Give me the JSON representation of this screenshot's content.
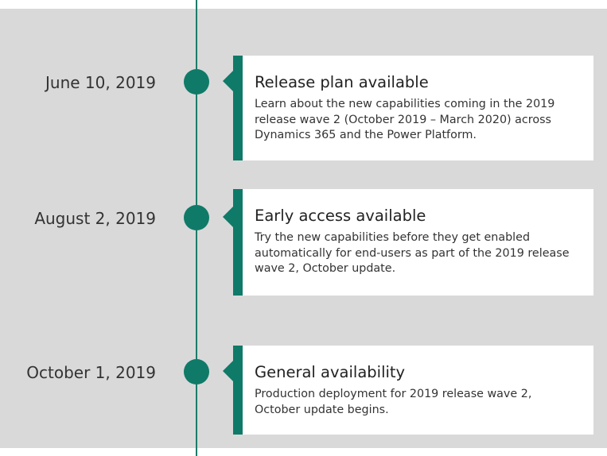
{
  "milestones": [
    {
      "date": "June 10, 2019",
      "title": "Release plan available",
      "description": "Learn about the new capabilities coming in the 2019 release wave 2 (October 2019 – March 2020) across Dynamics 365 and the Power Platform."
    },
    {
      "date": "August 2, 2019",
      "title": "Early access available",
      "description": "Try the new capabilities before they get enabled automatically for end-users as part of the 2019 release wave 2, October update."
    },
    {
      "date": "October 1, 2019",
      "title": "General availability",
      "description": "Production deployment for 2019 release wave 2, October update begins."
    }
  ],
  "colors": {
    "accent": "#0f7a68",
    "background": "#d9d9d9",
    "card": "#ffffff"
  }
}
